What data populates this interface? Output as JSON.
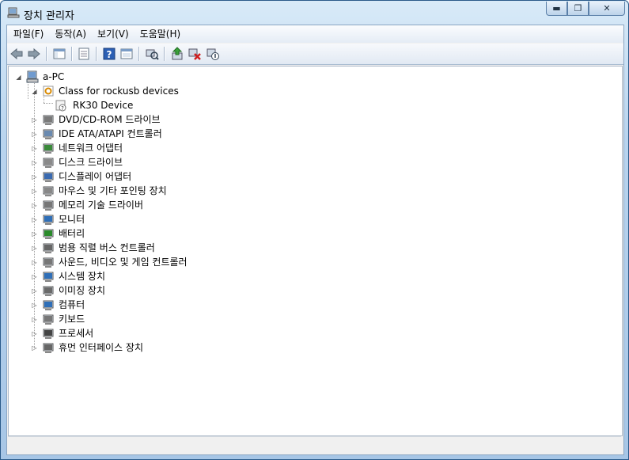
{
  "window": {
    "title": "장치 관리자"
  },
  "caption": {
    "minimize": "▬",
    "maximize": "❐",
    "close": "✕"
  },
  "menu": [
    {
      "label": "파일(F)"
    },
    {
      "label": "동작(A)"
    },
    {
      "label": "보기(V)"
    },
    {
      "label": "도움말(H)"
    }
  ],
  "toolbar": {
    "buttons": [
      "back-icon",
      "forward-icon",
      "show-hide-console-tree-icon",
      "properties-icon",
      "help-icon",
      "export-list-icon",
      "scan-hardware-icon",
      "update-driver-icon",
      "uninstall-icon",
      "disable-icon"
    ]
  },
  "tree": {
    "root": "a-PC",
    "expanded_group": "Class for rockusb devices",
    "expanded_child": "RK30 Device",
    "categories": [
      "DVD/CD-ROM 드라이브",
      "IDE ATA/ATAPI 컨트롤러",
      "네트워크 어댑터",
      "디스크 드라이브",
      "디스플레이 어댑터",
      "마우스 및 기타 포인팅 장치",
      "메모리 기술 드라이버",
      "모니터",
      "배터리",
      "범용 직렬 버스 컨트롤러",
      "사운드, 비디오 및 게임 컨트롤러",
      "시스템 장치",
      "이미징 장치",
      "컴퓨터",
      "키보드",
      "프로세서",
      "휴먼 인터페이스 장치"
    ],
    "category_icons": [
      "dvd-drive-icon",
      "ide-controller-icon",
      "network-adapter-icon",
      "disk-drive-icon",
      "display-adapter-icon",
      "mouse-icon",
      "memory-icon",
      "monitor-icon",
      "battery-icon",
      "usb-icon",
      "sound-icon",
      "system-device-icon",
      "imaging-device-icon",
      "computer-icon",
      "keyboard-icon",
      "processor-icon",
      "hid-icon"
    ]
  }
}
